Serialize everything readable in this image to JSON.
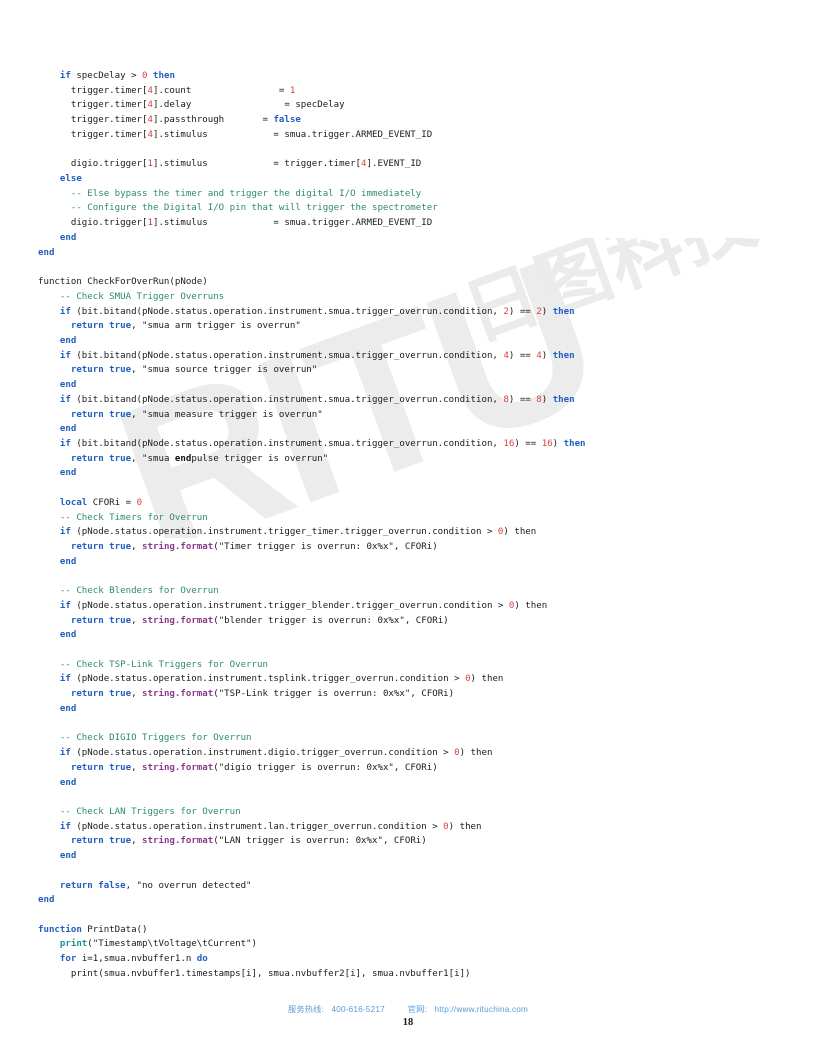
{
  "document": {
    "page_number": "18",
    "language": "Lua"
  },
  "watermark": {
    "latin_text": "RITU",
    "cjk_text": "日图科技",
    "color": "#eceded"
  },
  "footer": {
    "hotline_label": "服务热线:",
    "hotline_value": "400-616-5217",
    "website_label": "官网:",
    "website_value": "http://www.rituchina.com",
    "color": "#5b9bd5"
  },
  "syntax_colors": {
    "keyword": "#1f5fbf",
    "comment": "#2e8b6e",
    "number": "#d9403f",
    "function_call": "#8b3a8b",
    "builtin": "#1a8f96",
    "plain": "#1a1a1a"
  },
  "code": {
    "lines": [
      [
        {
          "t": "    ",
          "c": "plain"
        },
        {
          "t": "if",
          "c": "kw"
        },
        {
          "t": " specDelay > ",
          "c": "plain"
        },
        {
          "t": "0",
          "c": "num"
        },
        {
          "t": " ",
          "c": "plain"
        },
        {
          "t": "then",
          "c": "kw"
        }
      ],
      [
        {
          "t": "      trigger.timer[",
          "c": "plain"
        },
        {
          "t": "4",
          "c": "num"
        },
        {
          "t": "].count                = ",
          "c": "plain"
        },
        {
          "t": "1",
          "c": "num"
        }
      ],
      [
        {
          "t": "      trigger.timer[",
          "c": "plain"
        },
        {
          "t": "4",
          "c": "num"
        },
        {
          "t": "].delay                 = specDelay",
          "c": "plain"
        }
      ],
      [
        {
          "t": "      trigger.timer[",
          "c": "plain"
        },
        {
          "t": "4",
          "c": "num"
        },
        {
          "t": "].passthrough       = ",
          "c": "plain"
        },
        {
          "t": "false",
          "c": "kw"
        }
      ],
      [
        {
          "t": "      trigger.timer[",
          "c": "plain"
        },
        {
          "t": "4",
          "c": "num"
        },
        {
          "t": "].stimulus            = smua.trigger.ARMED_EVENT_ID",
          "c": "plain"
        }
      ],
      [],
      [
        {
          "t": "      digio.trigger[",
          "c": "plain"
        },
        {
          "t": "1",
          "c": "num"
        },
        {
          "t": "].stimulus            = trigger.timer[",
          "c": "plain"
        },
        {
          "t": "4",
          "c": "num"
        },
        {
          "t": "].EVENT_ID",
          "c": "plain"
        }
      ],
      [
        {
          "t": "    ",
          "c": "plain"
        },
        {
          "t": "else",
          "c": "kw"
        }
      ],
      [
        {
          "t": "      ",
          "c": "plain"
        },
        {
          "t": "-- Else bypass the timer and trigger the digital I/O immediately",
          "c": "cmt"
        }
      ],
      [
        {
          "t": "      ",
          "c": "plain"
        },
        {
          "t": "-- Configure the Digital I/O pin that will trigger the spectrometer",
          "c": "cmt"
        }
      ],
      [
        {
          "t": "      digio.trigger[",
          "c": "plain"
        },
        {
          "t": "1",
          "c": "num"
        },
        {
          "t": "].stimulus            = smua.trigger.ARMED_EVENT_ID",
          "c": "plain"
        }
      ],
      [
        {
          "t": "    ",
          "c": "plain"
        },
        {
          "t": "end",
          "c": "kw"
        }
      ],
      [
        {
          "t": "end",
          "c": "kw"
        }
      ],
      [],
      [
        {
          "t": "function CheckForOverRun(pNode)",
          "c": "plain"
        }
      ],
      [
        {
          "t": "    ",
          "c": "plain"
        },
        {
          "t": "-- Check SMUA Trigger Overruns",
          "c": "cmt"
        }
      ],
      [
        {
          "t": "    ",
          "c": "plain"
        },
        {
          "t": "if",
          "c": "kw"
        },
        {
          "t": " (bit.bitand(pNode.status.operation.instrument.smua.trigger_overrun.condition, ",
          "c": "plain"
        },
        {
          "t": "2",
          "c": "num"
        },
        {
          "t": ") == ",
          "c": "plain"
        },
        {
          "t": "2",
          "c": "num"
        },
        {
          "t": ") ",
          "c": "plain"
        },
        {
          "t": "then",
          "c": "kw"
        }
      ],
      [
        {
          "t": "      ",
          "c": "plain"
        },
        {
          "t": "return true",
          "c": "kw"
        },
        {
          "t": ", \"smua arm trigger is overrun\"",
          "c": "plain"
        }
      ],
      [
        {
          "t": "    ",
          "c": "plain"
        },
        {
          "t": "end",
          "c": "kw"
        }
      ],
      [
        {
          "t": "    ",
          "c": "plain"
        },
        {
          "t": "if",
          "c": "kw"
        },
        {
          "t": " (bit.bitand(pNode.status.operation.instrument.smua.trigger_overrun.condition, ",
          "c": "plain"
        },
        {
          "t": "4",
          "c": "num"
        },
        {
          "t": ") == ",
          "c": "plain"
        },
        {
          "t": "4",
          "c": "num"
        },
        {
          "t": ") ",
          "c": "plain"
        },
        {
          "t": "then",
          "c": "kw"
        }
      ],
      [
        {
          "t": "      ",
          "c": "plain"
        },
        {
          "t": "return true",
          "c": "kw"
        },
        {
          "t": ", \"smua source trigger is overrun\"",
          "c": "plain"
        }
      ],
      [
        {
          "t": "    ",
          "c": "plain"
        },
        {
          "t": "end",
          "c": "kw"
        }
      ],
      [
        {
          "t": "    ",
          "c": "plain"
        },
        {
          "t": "if",
          "c": "kw"
        },
        {
          "t": " (bit.bitand(pNode.status.operation.instrument.smua.trigger_overrun.condition, ",
          "c": "plain"
        },
        {
          "t": "8",
          "c": "num"
        },
        {
          "t": ") == ",
          "c": "plain"
        },
        {
          "t": "8",
          "c": "num"
        },
        {
          "t": ") ",
          "c": "plain"
        },
        {
          "t": "then",
          "c": "kw"
        }
      ],
      [
        {
          "t": "      ",
          "c": "plain"
        },
        {
          "t": "return true",
          "c": "kw"
        },
        {
          "t": ", \"smua measure trigger is overrun\"",
          "c": "plain"
        }
      ],
      [
        {
          "t": "    ",
          "c": "plain"
        },
        {
          "t": "end",
          "c": "kw"
        }
      ],
      [
        {
          "t": "    ",
          "c": "plain"
        },
        {
          "t": "if",
          "c": "kw"
        },
        {
          "t": " (bit.bitand(pNode.status.operation.instrument.smua.trigger_overrun.condition, ",
          "c": "plain"
        },
        {
          "t": "16",
          "c": "num"
        },
        {
          "t": ") == ",
          "c": "plain"
        },
        {
          "t": "16",
          "c": "num"
        },
        {
          "t": ") ",
          "c": "plain"
        },
        {
          "t": "then",
          "c": "kw"
        }
      ],
      [
        {
          "t": "      ",
          "c": "plain"
        },
        {
          "t": "return true",
          "c": "kw"
        },
        {
          "t": ", \"smua ",
          "c": "plain"
        },
        {
          "t": "end",
          "c": "bold-black"
        },
        {
          "t": "pulse trigger is overrun\"",
          "c": "plain"
        }
      ],
      [
        {
          "t": "    ",
          "c": "plain"
        },
        {
          "t": "end",
          "c": "kw"
        }
      ],
      [],
      [
        {
          "t": "    ",
          "c": "plain"
        },
        {
          "t": "local",
          "c": "kw"
        },
        {
          "t": " CFORi = ",
          "c": "plain"
        },
        {
          "t": "0",
          "c": "num"
        }
      ],
      [
        {
          "t": "    ",
          "c": "plain"
        },
        {
          "t": "-- Check Timers for Overrun",
          "c": "cmt"
        }
      ],
      [
        {
          "t": "    ",
          "c": "plain"
        },
        {
          "t": "if",
          "c": "kw"
        },
        {
          "t": " (pNode.status.operation.instrument.trigger_timer.trigger_overrun.condition > ",
          "c": "plain"
        },
        {
          "t": "0",
          "c": "num"
        },
        {
          "t": ") then",
          "c": "plain"
        }
      ],
      [
        {
          "t": "      ",
          "c": "plain"
        },
        {
          "t": "return true",
          "c": "kw"
        },
        {
          "t": ", ",
          "c": "plain"
        },
        {
          "t": "string.format",
          "c": "fn"
        },
        {
          "t": "(\"Timer trigger is overrun: 0x%x\", CFORi)",
          "c": "plain"
        }
      ],
      [
        {
          "t": "    ",
          "c": "plain"
        },
        {
          "t": "end",
          "c": "kw"
        }
      ],
      [],
      [
        {
          "t": "    ",
          "c": "plain"
        },
        {
          "t": "-- Check Blenders for Overrun",
          "c": "cmt"
        }
      ],
      [
        {
          "t": "    ",
          "c": "plain"
        },
        {
          "t": "if",
          "c": "kw"
        },
        {
          "t": " (pNode.status.operation.instrument.trigger_blender.trigger_overrun.condition > ",
          "c": "plain"
        },
        {
          "t": "0",
          "c": "num"
        },
        {
          "t": ") then",
          "c": "plain"
        }
      ],
      [
        {
          "t": "      ",
          "c": "plain"
        },
        {
          "t": "return true",
          "c": "kw"
        },
        {
          "t": ", ",
          "c": "plain"
        },
        {
          "t": "string.format",
          "c": "fn"
        },
        {
          "t": "(\"blender trigger is overrun: 0x%x\", CFORi)",
          "c": "plain"
        }
      ],
      [
        {
          "t": "    ",
          "c": "plain"
        },
        {
          "t": "end",
          "c": "kw"
        }
      ],
      [],
      [
        {
          "t": "    ",
          "c": "plain"
        },
        {
          "t": "-- Check TSP-Link Triggers for Overrun",
          "c": "cmt"
        }
      ],
      [
        {
          "t": "    ",
          "c": "plain"
        },
        {
          "t": "if",
          "c": "kw"
        },
        {
          "t": " (pNode.status.operation.instrument.tsplink.trigger_overrun.condition > ",
          "c": "plain"
        },
        {
          "t": "0",
          "c": "num"
        },
        {
          "t": ") then",
          "c": "plain"
        }
      ],
      [
        {
          "t": "      ",
          "c": "plain"
        },
        {
          "t": "return true",
          "c": "kw"
        },
        {
          "t": ", ",
          "c": "plain"
        },
        {
          "t": "string.format",
          "c": "fn"
        },
        {
          "t": "(\"TSP-Link trigger is overrun: 0x%x\", CFORi)",
          "c": "plain"
        }
      ],
      [
        {
          "t": "    ",
          "c": "plain"
        },
        {
          "t": "end",
          "c": "kw"
        }
      ],
      [],
      [
        {
          "t": "    ",
          "c": "plain"
        },
        {
          "t": "-- Check DIGIO Triggers for Overrun",
          "c": "cmt"
        }
      ],
      [
        {
          "t": "    ",
          "c": "plain"
        },
        {
          "t": "if",
          "c": "kw"
        },
        {
          "t": " (pNode.status.operation.instrument.digio.trigger_overrun.condition > ",
          "c": "plain"
        },
        {
          "t": "0",
          "c": "num"
        },
        {
          "t": ") then",
          "c": "plain"
        }
      ],
      [
        {
          "t": "      ",
          "c": "plain"
        },
        {
          "t": "return true",
          "c": "kw"
        },
        {
          "t": ", ",
          "c": "plain"
        },
        {
          "t": "string.format",
          "c": "fn"
        },
        {
          "t": "(\"digio trigger is overrun: 0x%x\", CFORi)",
          "c": "plain"
        }
      ],
      [
        {
          "t": "    ",
          "c": "plain"
        },
        {
          "t": "end",
          "c": "kw"
        }
      ],
      [],
      [
        {
          "t": "    ",
          "c": "plain"
        },
        {
          "t": "-- Check LAN Triggers for Overrun",
          "c": "cmt"
        }
      ],
      [
        {
          "t": "    ",
          "c": "plain"
        },
        {
          "t": "if",
          "c": "kw"
        },
        {
          "t": " (pNode.status.operation.instrument.lan.trigger_overrun.condition > ",
          "c": "plain"
        },
        {
          "t": "0",
          "c": "num"
        },
        {
          "t": ") then",
          "c": "plain"
        }
      ],
      [
        {
          "t": "      ",
          "c": "plain"
        },
        {
          "t": "return true",
          "c": "kw"
        },
        {
          "t": ", ",
          "c": "plain"
        },
        {
          "t": "string.format",
          "c": "fn"
        },
        {
          "t": "(\"LAN trigger is overrun: 0x%x\", CFORi)",
          "c": "plain"
        }
      ],
      [
        {
          "t": "    ",
          "c": "plain"
        },
        {
          "t": "end",
          "c": "kw"
        }
      ],
      [],
      [
        {
          "t": "    ",
          "c": "plain"
        },
        {
          "t": "return false",
          "c": "kw"
        },
        {
          "t": ", \"no overrun detected\"",
          "c": "plain"
        }
      ],
      [
        {
          "t": "end",
          "c": "kw"
        }
      ],
      [],
      [
        {
          "t": "function",
          "c": "kw"
        },
        {
          "t": " PrintData()",
          "c": "plain"
        }
      ],
      [
        {
          "t": "    ",
          "c": "plain"
        },
        {
          "t": "print",
          "c": "builtin"
        },
        {
          "t": "(\"Timestamp\\tVoltage\\tCurrent\")",
          "c": "plain"
        }
      ],
      [
        {
          "t": "    ",
          "c": "plain"
        },
        {
          "t": "for",
          "c": "kw"
        },
        {
          "t": " i=1,smua.nvbuffer1.n ",
          "c": "plain"
        },
        {
          "t": "do",
          "c": "kw"
        }
      ],
      [
        {
          "t": "      print(smua.nvbuffer1.timestamps[i], smua.nvbuffer2[i], smua.nvbuffer1[i])",
          "c": "plain"
        }
      ]
    ]
  }
}
